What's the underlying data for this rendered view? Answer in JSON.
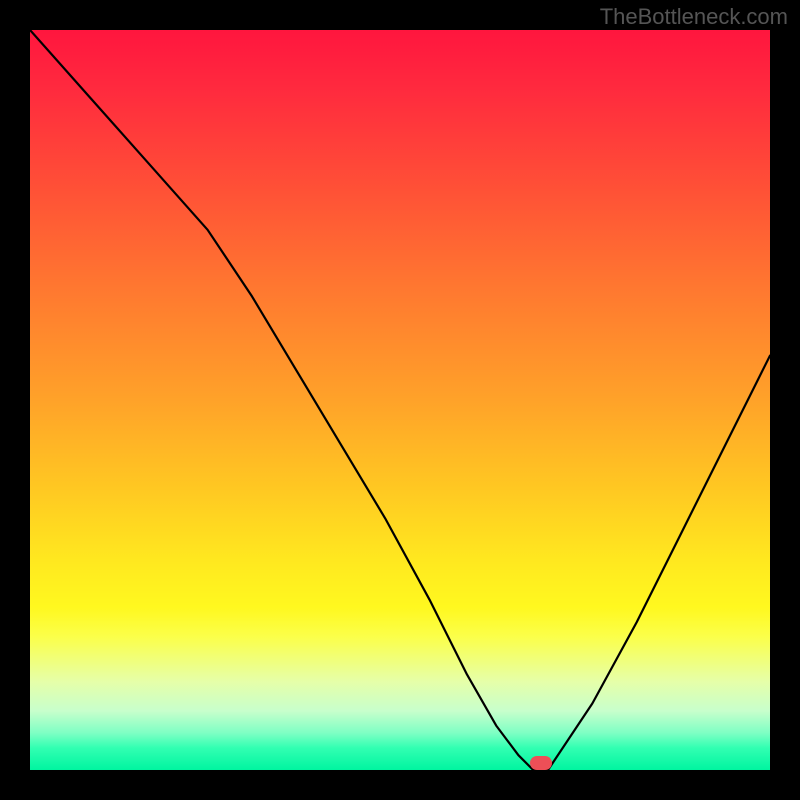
{
  "watermark": "TheBottleneck.com",
  "colors": {
    "background": "#000000",
    "gradient_top": "#ff163e",
    "gradient_bottom": "#00f5a0",
    "curve": "#000000",
    "marker": "#ed4f57"
  },
  "chart_data": {
    "type": "line",
    "title": "",
    "xlabel": "",
    "ylabel": "",
    "xlim": [
      0,
      100
    ],
    "ylim": [
      0,
      100
    ],
    "series": [
      {
        "name": "bottleneck-curve",
        "x": [
          0,
          8,
          16,
          24,
          30,
          36,
          42,
          48,
          54,
          59,
          63,
          66,
          68,
          70,
          76,
          82,
          88,
          94,
          100
        ],
        "values": [
          100,
          91,
          82,
          73,
          64,
          54,
          44,
          34,
          23,
          13,
          6,
          2,
          0,
          0,
          9,
          20,
          32,
          44,
          56
        ]
      }
    ],
    "marker": {
      "x": 69,
      "y": 1,
      "color": "#ed4f57"
    },
    "annotations": [
      {
        "text": "TheBottleneck.com",
        "position": "top-right"
      }
    ]
  }
}
